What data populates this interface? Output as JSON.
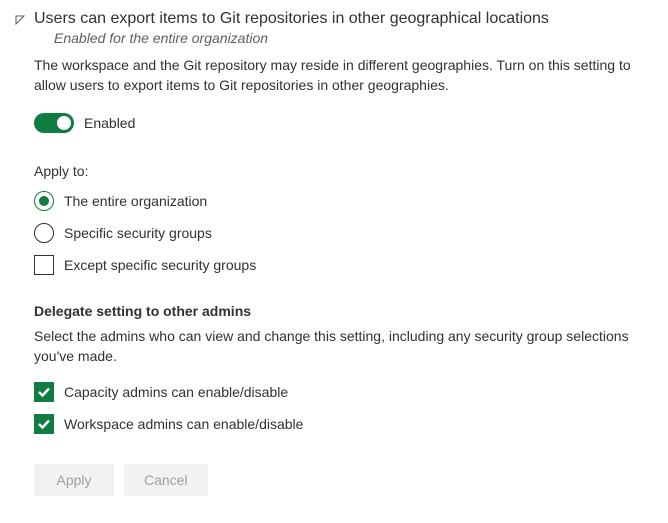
{
  "header": {
    "title": "Users can export items to Git repositories in other geographical locations",
    "subtitle": "Enabled for the entire organization",
    "description": "The workspace and the Git repository may reside in different geographies. Turn on this setting to allow users to export items to Git repositories in other geographies."
  },
  "toggle": {
    "label": "Enabled"
  },
  "applyTo": {
    "label": "Apply to:",
    "options": {
      "entireOrg": "The entire organization",
      "specificGroups": "Specific security groups"
    },
    "except": "Except specific security groups"
  },
  "delegate": {
    "label": "Delegate setting to other admins",
    "description": "Select the admins who can view and change this setting, including any security group selections you've made.",
    "capacityAdmins": "Capacity admins can enable/disable",
    "workspaceAdmins": "Workspace admins can enable/disable"
  },
  "buttons": {
    "apply": "Apply",
    "cancel": "Cancel"
  }
}
